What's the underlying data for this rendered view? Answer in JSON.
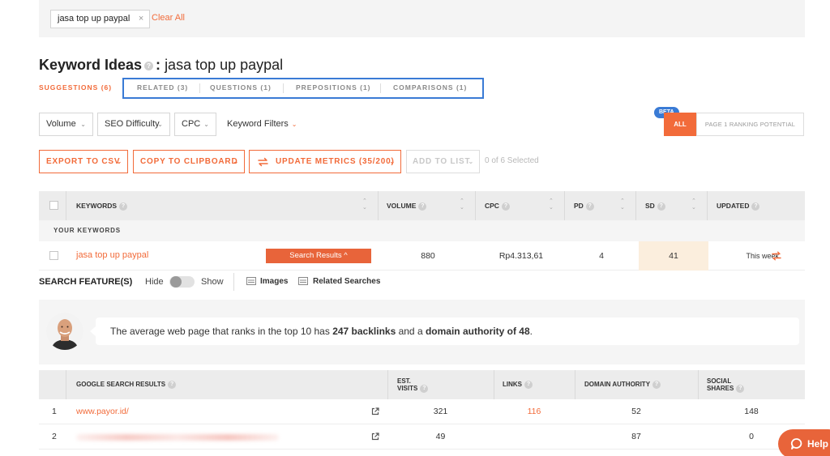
{
  "search_bar": {
    "chip_text": "jasa top up paypal",
    "chip_close": "×",
    "clear_all": "Clear All"
  },
  "header": {
    "title": "Keyword Ideas",
    "separator": ":",
    "query": "jasa top up paypal"
  },
  "subtabs": [
    {
      "label": "SUGGESTIONS (6)",
      "active": true
    },
    {
      "label": "RELATED (3)",
      "active": false
    },
    {
      "label": "QUESTIONS (1)",
      "active": false
    },
    {
      "label": "PREPOSITIONS (1)",
      "active": false
    },
    {
      "label": "COMPARISONS (1)",
      "active": false
    }
  ],
  "filters": {
    "volume": "Volume",
    "seo_difficulty": "SEO Difficulty",
    "cpc": "CPC",
    "keyword_filters": "Keyword Filters"
  },
  "ranking_toggle": {
    "beta": "BETA",
    "all": "ALL",
    "page1": "PAGE 1 RANKING POTENTIAL"
  },
  "actions": {
    "export": "EXPORT TO CSV",
    "copy": "COPY TO CLIPBOARD",
    "update": "UPDATE METRICS (35/200)",
    "add_to_list": "ADD TO LIST",
    "selected": "0 of 6 Selected"
  },
  "keywords_table": {
    "columns": {
      "keywords": "KEYWORDS",
      "volume": "VOLUME",
      "cpc": "CPC",
      "pd": "PD",
      "sd": "SD",
      "updated": "UPDATED"
    },
    "section_label": "YOUR KEYWORDS",
    "row": {
      "keyword": "jasa top up paypal",
      "search_results_btn": "Search Results ^",
      "volume": "880",
      "cpc": "Rp4.313,61",
      "pd": "4",
      "sd": "41",
      "updated": "This week"
    }
  },
  "search_features": {
    "label": "SEARCH FEATURE(S)",
    "hide": "Hide",
    "show": "Show",
    "items": [
      "Images",
      "Related Searches"
    ]
  },
  "tip": {
    "text_1": "The average web page that ranks in the top 10 has ",
    "backlinks": "247 backlinks",
    "text_2": " and a ",
    "domain_authority": "domain authority of 48",
    "text_3": "."
  },
  "serp_table": {
    "columns": {
      "results": "GOOGLE SEARCH RESULTS",
      "est_visits_1": "EST.",
      "est_visits_2": "VISITS",
      "links": "LINKS",
      "domain_authority": "DOMAIN AUTHORITY",
      "social_1": "SOCIAL",
      "social_2": "SHARES"
    },
    "rows": [
      {
        "rank": "1",
        "url": "www.payor.id/",
        "visits": "321",
        "links": "116",
        "domain_authority": "52",
        "social": "148"
      },
      {
        "rank": "2",
        "url": "",
        "visits": "49",
        "links": "",
        "domain_authority": "87",
        "social": "0"
      }
    ]
  },
  "help": {
    "label": "Help"
  },
  "colors": {
    "accent": "#f26b3a",
    "highlight_box": "#3a7bd5",
    "sd_cell": "#fbeedd"
  }
}
